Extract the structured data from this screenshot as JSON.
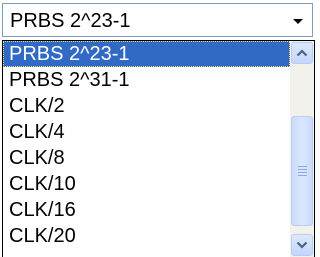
{
  "combo": {
    "value": "PRBS 2^23-1",
    "button_icon": "chevron-down-icon"
  },
  "dropdown": {
    "items": [
      {
        "label": "PRBS 2^23-1",
        "selected": true
      },
      {
        "label": "PRBS 2^31-1",
        "selected": false
      },
      {
        "label": "CLK/2",
        "selected": false
      },
      {
        "label": "CLK/4",
        "selected": false
      },
      {
        "label": "CLK/8",
        "selected": false
      },
      {
        "label": "CLK/10",
        "selected": false
      },
      {
        "label": "CLK/16",
        "selected": false
      },
      {
        "label": "CLK/20",
        "selected": false
      }
    ],
    "scrollbar": {
      "up_icon": "chevron-up-icon",
      "down_icon": "chevron-down-icon",
      "scroll_position": 0.45
    }
  },
  "colors": {
    "selection_bg": "#316ac5",
    "selection_text": "#ffffff",
    "border": "#7f9db9"
  }
}
